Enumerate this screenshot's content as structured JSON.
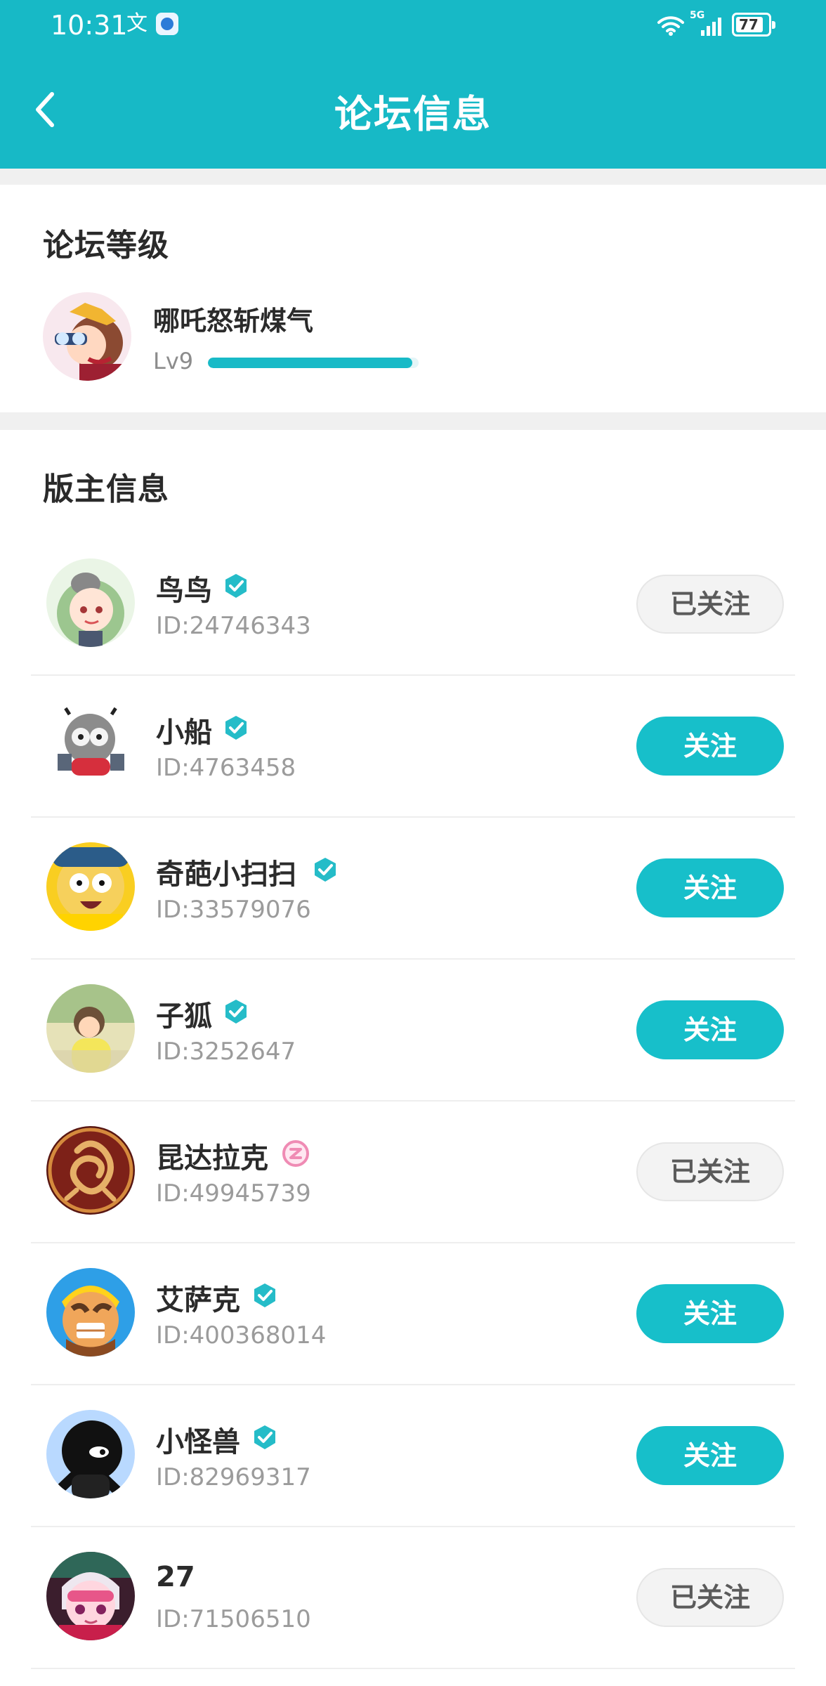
{
  "status_bar": {
    "time": "10:31",
    "network_label": "5G",
    "battery_level": "77"
  },
  "header": {
    "title": "论坛信息"
  },
  "level_section": {
    "title": "论坛等级",
    "user_name": "哪吒怒斩煤气",
    "level": "Lv9",
    "progress_fraction": 0.97
  },
  "moderator_section": {
    "title": "版主信息",
    "items": [
      {
        "name": "鸟鸟",
        "id": "ID:24746343",
        "follow_label": "已关注",
        "followed": true,
        "badge": "verified-check-icon"
      },
      {
        "name": "小船",
        "id": "ID:4763458",
        "follow_label": "关注",
        "followed": false,
        "badge": "verified-check-icon"
      },
      {
        "name": "奇葩小扫扫",
        "id": "ID:33579076",
        "follow_label": "关注",
        "followed": false,
        "badge": "verified-check-icon"
      },
      {
        "name": "子狐",
        "id": "ID:3252647",
        "follow_label": "关注",
        "followed": false,
        "badge": "verified-check-icon"
      },
      {
        "name": "昆达拉克",
        "id": "ID:49945739",
        "follow_label": "已关注",
        "followed": true,
        "badge": "pink-badge-icon"
      },
      {
        "name": "艾萨克",
        "id": "ID:400368014",
        "follow_label": "关注",
        "followed": false,
        "badge": "verified-check-icon"
      },
      {
        "name": "小怪兽",
        "id": "ID:82969317",
        "follow_label": "关注",
        "followed": false,
        "badge": "verified-check-icon"
      },
      {
        "name": "27",
        "id": "ID:71506510",
        "follow_label": "已关注",
        "followed": true,
        "badge": ""
      }
    ]
  },
  "colors": {
    "accent": "#17b9c6",
    "follow_button": "#17bfca",
    "verified_badge": "#25bcc8",
    "pink_badge": "#ef8bb4"
  }
}
